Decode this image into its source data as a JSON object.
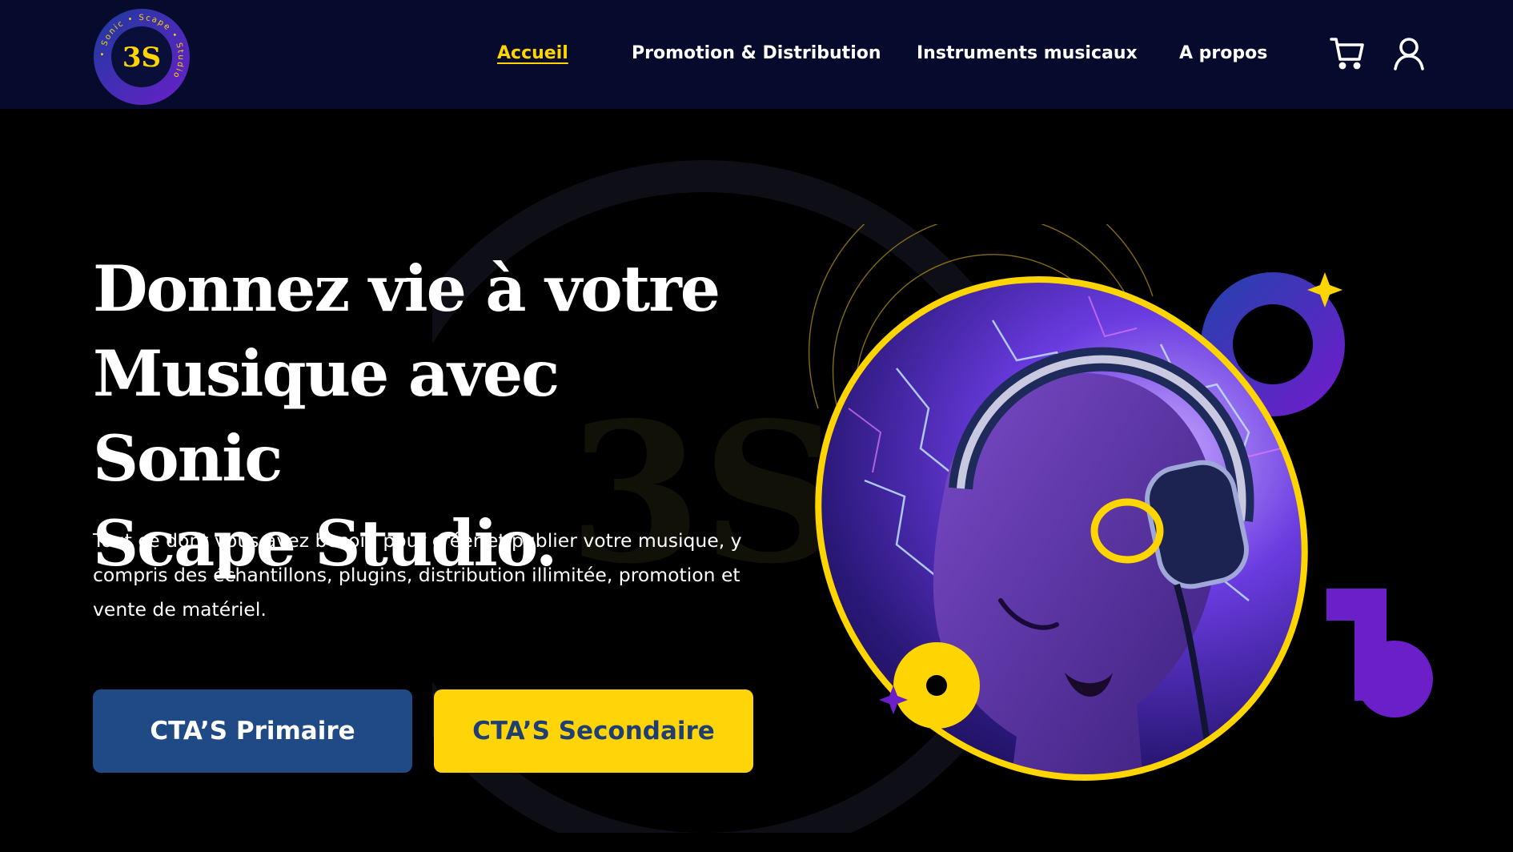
{
  "brand": {
    "logo_text": "3S",
    "logo_ring_text": "• Sonic • Scape • Studio",
    "colors": {
      "navy": "#060b2e",
      "yellow": "#ffd500",
      "purple": "#6a1fc9",
      "blue_button": "#1f4a85"
    }
  },
  "nav": {
    "items": [
      {
        "label": "Accueil",
        "active": true
      },
      {
        "label": "Promotion & Distribution",
        "active": false
      },
      {
        "label": "Instruments musicaux",
        "active": false
      },
      {
        "label": "A propos",
        "active": false
      }
    ],
    "cart_icon": "cart-icon",
    "account_icon": "user-icon"
  },
  "hero": {
    "title": "Donnez vie à votre\nMusique avec Sonic\nScape Studio.",
    "description": "Tout ce dont vous avez besoin pour créer et publier votre musique, y compris des échantillons, plugins, distribution illimitée, promotion et vente de matériel.",
    "primary_cta": "CTA’S Primaire",
    "secondary_cta": "CTA’S Secondaire",
    "background_watermark": "3S"
  }
}
